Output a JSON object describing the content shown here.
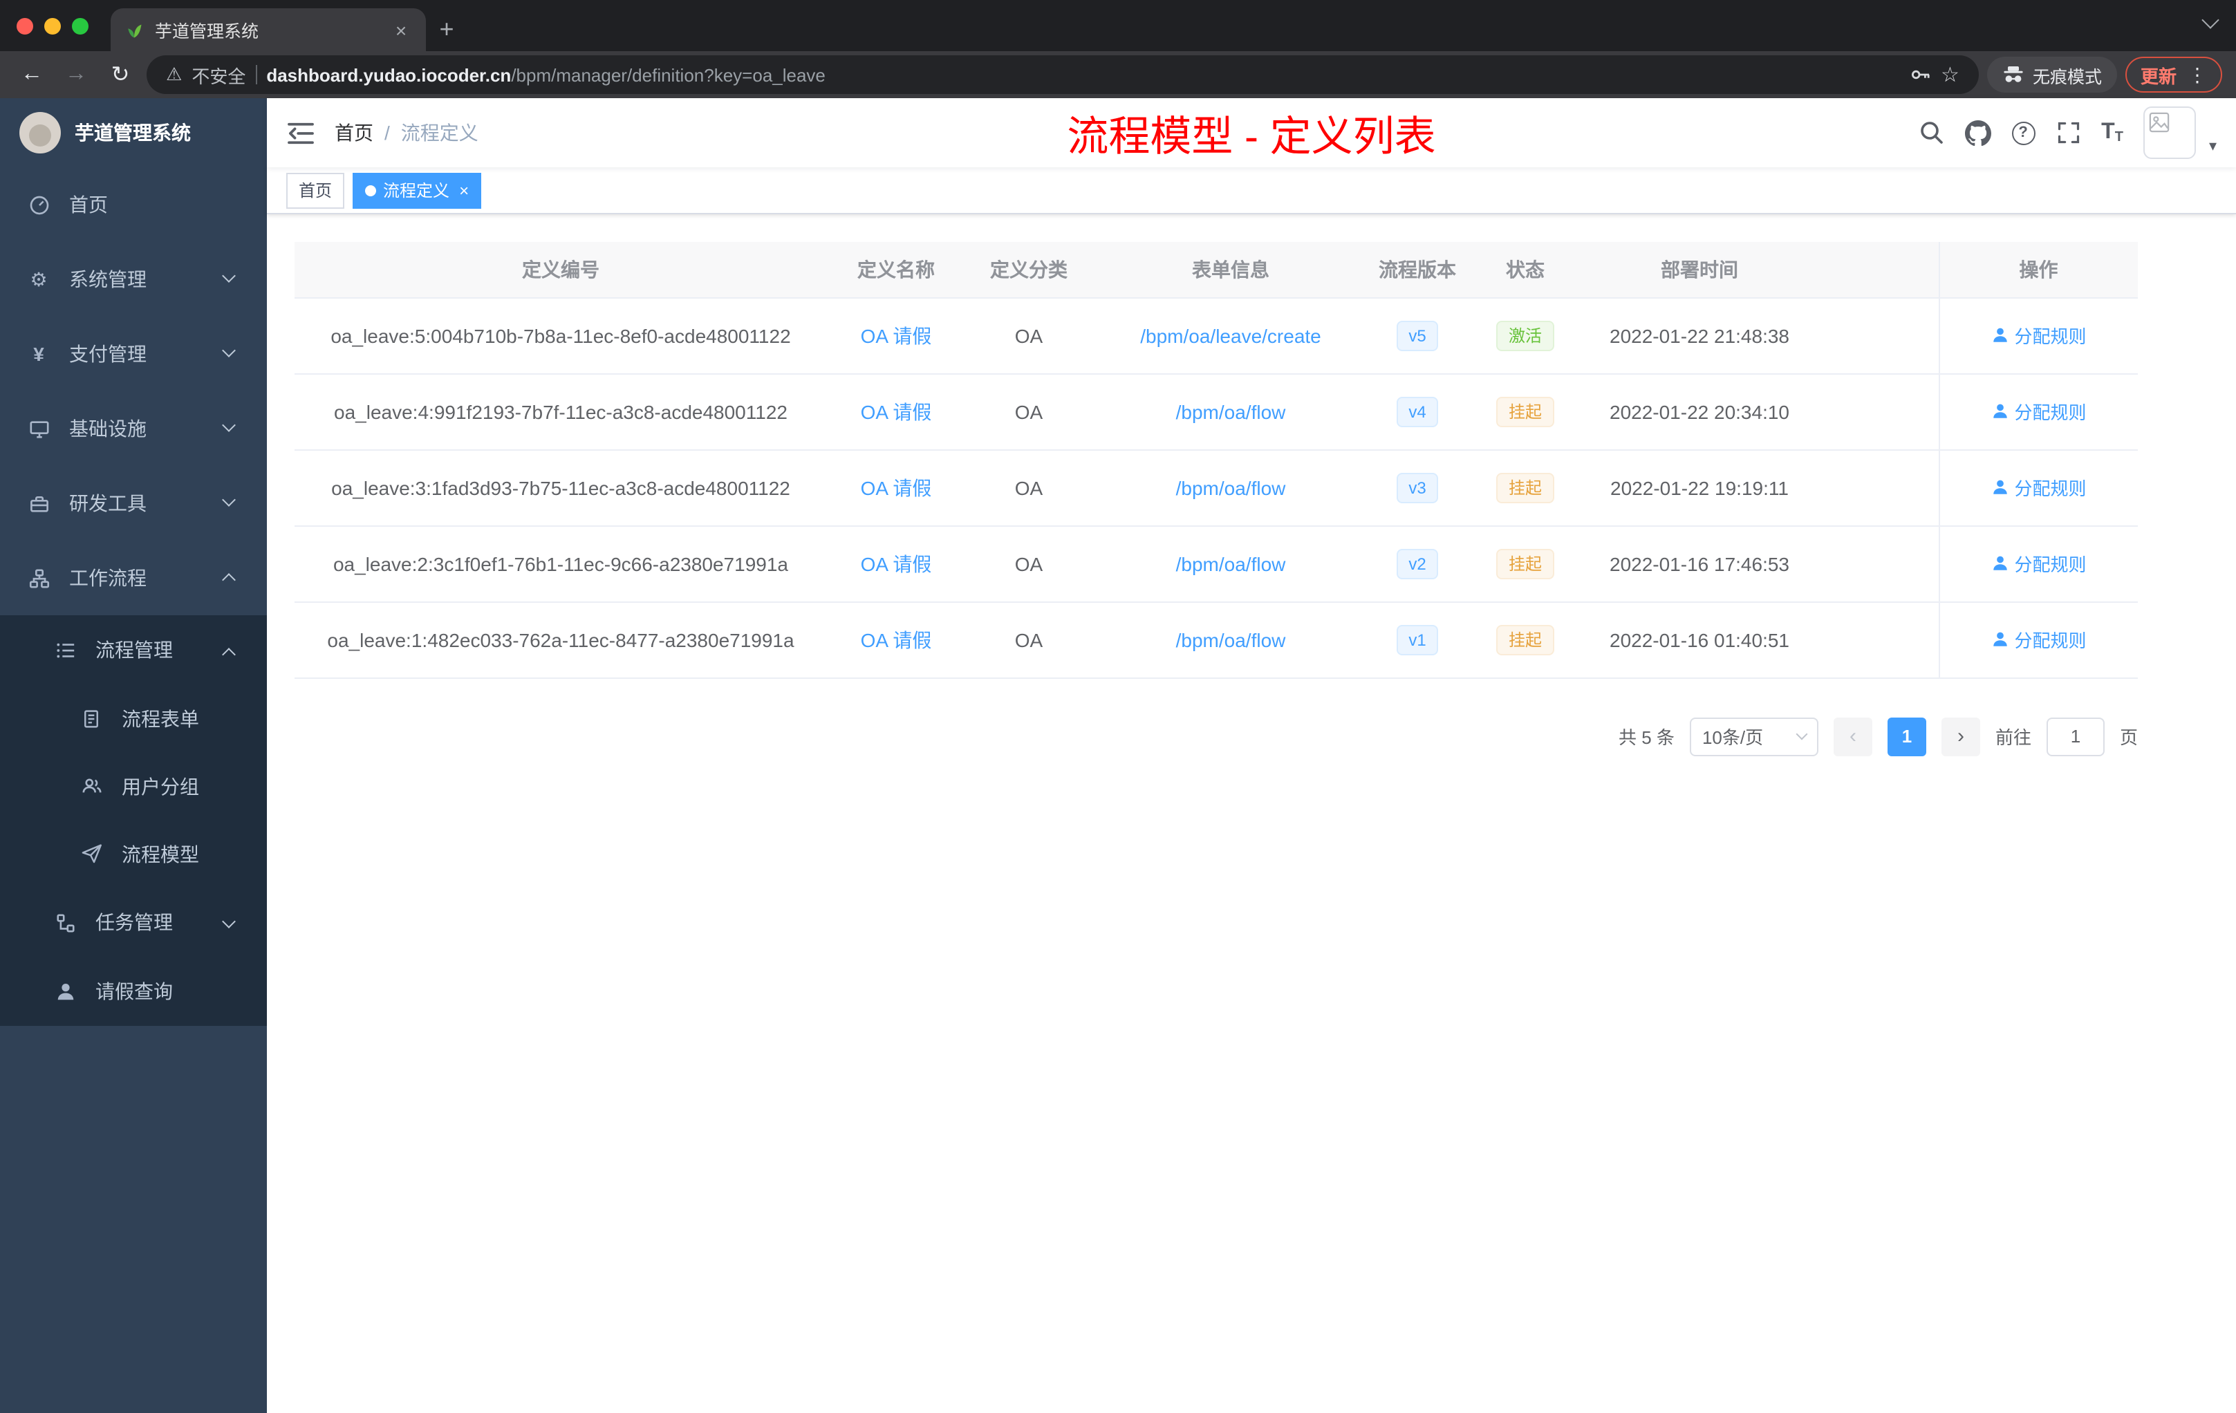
{
  "colors": {
    "accent": "#409eff",
    "page_title_red": "#ff0000",
    "status_active_green": "#67c23a",
    "status_suspend_orange": "#e6a23c",
    "sidebar_bg": "#304156",
    "sidebar_submenu_bg": "#1f2d3d"
  },
  "icons": {
    "warning": "⚠",
    "back": "←",
    "forward": "→",
    "reload": "↻",
    "star": "☆",
    "menu_dots": "⋮",
    "question": "?",
    "close": "×",
    "plus": "+",
    "gear": "⚙",
    "yen": "¥",
    "caret_down": "▾",
    "prev_arrow": "‹",
    "next_arrow": "›",
    "font_big": "T",
    "font_small": "T"
  },
  "browser": {
    "tab_title": "芋道管理系统",
    "security_label": "不安全",
    "url_host": "dashboard.yudao.iocoder.cn",
    "url_path": "/bpm/manager/definition?key=oa_leave",
    "incognito_label": "无痕模式",
    "update_label": "更新"
  },
  "sidebar": {
    "logo_title": "芋道管理系统",
    "items": [
      {
        "label": "首页"
      },
      {
        "label": "系统管理"
      },
      {
        "label": "支付管理"
      },
      {
        "label": "基础设施"
      },
      {
        "label": "研发工具"
      },
      {
        "label": "工作流程"
      },
      {
        "label": "流程管理"
      },
      {
        "label": "流程表单"
      },
      {
        "label": "用户分组"
      },
      {
        "label": "流程模型"
      },
      {
        "label": "任务管理"
      },
      {
        "label": "请假查询"
      }
    ]
  },
  "header": {
    "breadcrumb_home": "首页",
    "breadcrumb_sep": "/",
    "breadcrumb_current": "流程定义",
    "page_title": "流程模型 - 定义列表"
  },
  "tags": {
    "home": "首页",
    "active": "流程定义"
  },
  "table": {
    "columns": {
      "id": "定义编号",
      "name": "定义名称",
      "category": "定义分类",
      "form": "表单信息",
      "version": "流程版本",
      "status": "状态",
      "deploy_time": "部署时间",
      "action": "操作"
    },
    "rows": [
      {
        "id": "oa_leave:5:004b710b-7b8a-11ec-8ef0-acde48001122",
        "name": "OA 请假",
        "category": "OA",
        "form": "/bpm/oa/leave/create",
        "version": "v5",
        "status": "激活",
        "status_type": "success",
        "time": "2022-01-22 21:48:38",
        "action": "分配规则"
      },
      {
        "id": "oa_leave:4:991f2193-7b7f-11ec-a3c8-acde48001122",
        "name": "OA 请假",
        "category": "OA",
        "form": "/bpm/oa/flow",
        "version": "v4",
        "status": "挂起",
        "status_type": "warning",
        "time": "2022-01-22 20:34:10",
        "action": "分配规则"
      },
      {
        "id": "oa_leave:3:1fad3d93-7b75-11ec-a3c8-acde48001122",
        "name": "OA 请假",
        "category": "OA",
        "form": "/bpm/oa/flow",
        "version": "v3",
        "status": "挂起",
        "status_type": "warning",
        "time": "2022-01-22 19:19:11",
        "action": "分配规则"
      },
      {
        "id": "oa_leave:2:3c1f0ef1-76b1-11ec-9c66-a2380e71991a",
        "name": "OA 请假",
        "category": "OA",
        "form": "/bpm/oa/flow",
        "version": "v2",
        "status": "挂起",
        "status_type": "warning",
        "time": "2022-01-16 17:46:53",
        "action": "分配规则"
      },
      {
        "id": "oa_leave:1:482ec033-762a-11ec-8477-a2380e71991a",
        "name": "OA 请假",
        "category": "OA",
        "form": "/bpm/oa/flow",
        "version": "v1",
        "status": "挂起",
        "status_type": "warning",
        "time": "2022-01-16 01:40:51",
        "action": "分配规则"
      }
    ]
  },
  "pagination": {
    "total": "共 5 条",
    "page_size": "10条/页",
    "page": "1",
    "goto_label": "前往",
    "goto_value": "1",
    "page_unit": "页"
  }
}
